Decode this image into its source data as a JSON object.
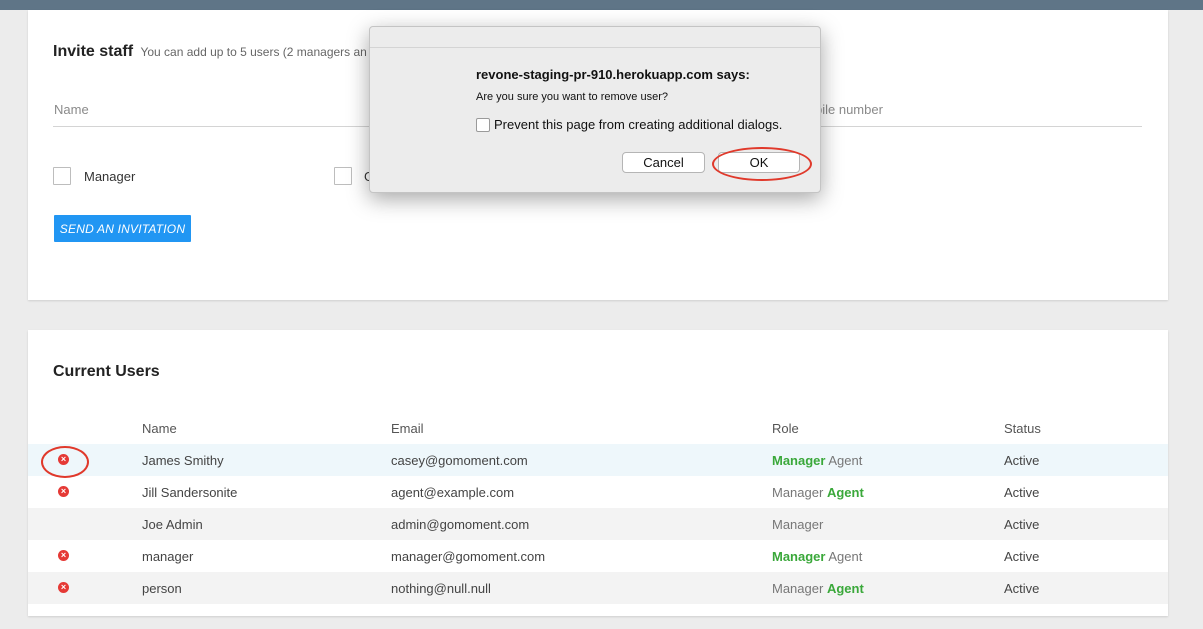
{
  "invite": {
    "title": "Invite staff",
    "subtitle": "You can add up to 5 users (2 managers an",
    "name_placeholder": "Name",
    "mobile_placeholder": "bile number",
    "manager_label": "Manager",
    "agent_label_partial": "G",
    "send_button": "SEND AN INVITATION"
  },
  "users": {
    "title": "Current Users",
    "headers": {
      "name": "Name",
      "email": "Email",
      "role": "Role",
      "status": "Status"
    },
    "rows": [
      {
        "name": "James Smithy",
        "email": "casey@gomoment.com",
        "role_manager": "Manager",
        "role_agent": "Agent",
        "status": "Active",
        "removable": true
      },
      {
        "name": "Jill Sandersonite",
        "email": "agent@example.com",
        "role_manager": "Manager",
        "role_agent": "Agent",
        "status": "Active",
        "removable": true
      },
      {
        "name": "Joe Admin",
        "email": "admin@gomoment.com",
        "role_manager": "Manager",
        "role_agent": "",
        "status": "Active",
        "removable": false
      },
      {
        "name": "manager",
        "email": "manager@gomoment.com",
        "role_manager": "Manager",
        "role_agent": "Agent",
        "status": "Active",
        "removable": true
      },
      {
        "name": "person",
        "email": "nothing@null.null",
        "role_manager": "Manager",
        "role_agent": "Agent",
        "status": "Active",
        "removable": true
      }
    ]
  },
  "dialog": {
    "title": "revone-staging-pr-910.herokuapp.com says:",
    "message": "Are you sure you want to remove user?",
    "checkbox_label": "Prevent this page from creating additional dialogs.",
    "cancel": "Cancel",
    "ok": "OK"
  },
  "colors": {
    "header_bar": "#5f7587",
    "primary_button": "#2196f3",
    "active_role": "#3aa83a",
    "remove_icon": "#e53935",
    "highlight_ring": "#e0392b"
  },
  "icons": {
    "remove": "remove-circle-icon"
  }
}
